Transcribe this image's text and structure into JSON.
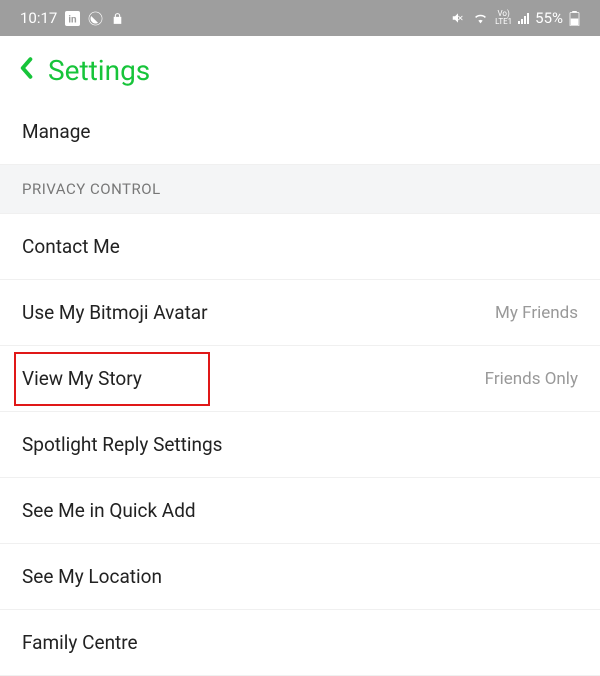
{
  "statusBar": {
    "time": "10:17",
    "lte": "Vo)\nLTE1",
    "battery": "55%"
  },
  "header": {
    "title": "Settings"
  },
  "items": [
    {
      "label": "Manage",
      "value": "",
      "type": "item"
    },
    {
      "label": "PRIVACY CONTROL",
      "value": "",
      "type": "section"
    },
    {
      "label": "Contact Me",
      "value": "",
      "type": "item"
    },
    {
      "label": "Use My Bitmoji Avatar",
      "value": "My Friends",
      "type": "item"
    },
    {
      "label": "View My Story",
      "value": "Friends Only",
      "type": "item",
      "highlighted": true
    },
    {
      "label": "Spotlight Reply Settings",
      "value": "",
      "type": "item"
    },
    {
      "label": "See Me in Quick Add",
      "value": "",
      "type": "item"
    },
    {
      "label": "See My Location",
      "value": "",
      "type": "item"
    },
    {
      "label": "Family Centre",
      "value": "",
      "type": "item"
    }
  ]
}
